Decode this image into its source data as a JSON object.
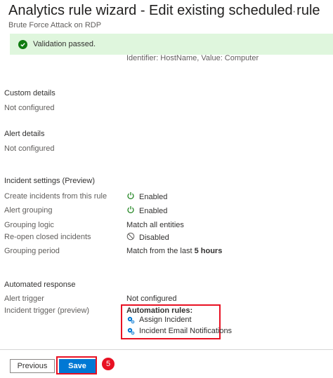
{
  "header": {
    "title": "Analytics rule wizard - Edit existing scheduled rule",
    "subtitle": "Brute Force Attack on RDP",
    "more_label": "···"
  },
  "banner": {
    "text": "Validation passed.",
    "icon": "check-circle-icon",
    "color": "#107c10"
  },
  "partial_row": "Identifier: HostName, Value: Computer",
  "custom_details": {
    "heading": "Custom details",
    "value": "Not configured"
  },
  "alert_details": {
    "heading": "Alert details",
    "value": "Not configured"
  },
  "incident_settings": {
    "heading": "Incident settings (Preview)",
    "rows": [
      {
        "label": "Create incidents from this rule",
        "value": "Enabled",
        "icon": "power-icon"
      },
      {
        "label": "Alert grouping",
        "value": "Enabled",
        "icon": "power-icon"
      },
      {
        "label": "Grouping logic",
        "value": "Match all entities"
      },
      {
        "label": "Re-open closed incidents",
        "value": "Disabled",
        "icon": "disabled-icon"
      },
      {
        "label": "Grouping period",
        "value_prefix": "Match from the last ",
        "value_bold": "5 hours"
      }
    ]
  },
  "automated_response": {
    "heading": "Automated response",
    "alert_trigger_label": "Alert trigger",
    "alert_trigger_value": "Not configured",
    "incident_trigger_label": "Incident trigger (preview)",
    "automation_rules_heading": "Automation rules:",
    "automation_rules": [
      "Assign Incident",
      "Incident Email Notifications"
    ]
  },
  "footer": {
    "previous_label": "Previous",
    "save_label": "Save",
    "step_number": "5"
  },
  "colors": {
    "accent": "#0078d4",
    "highlight": "#e81123",
    "success": "#107c10"
  }
}
